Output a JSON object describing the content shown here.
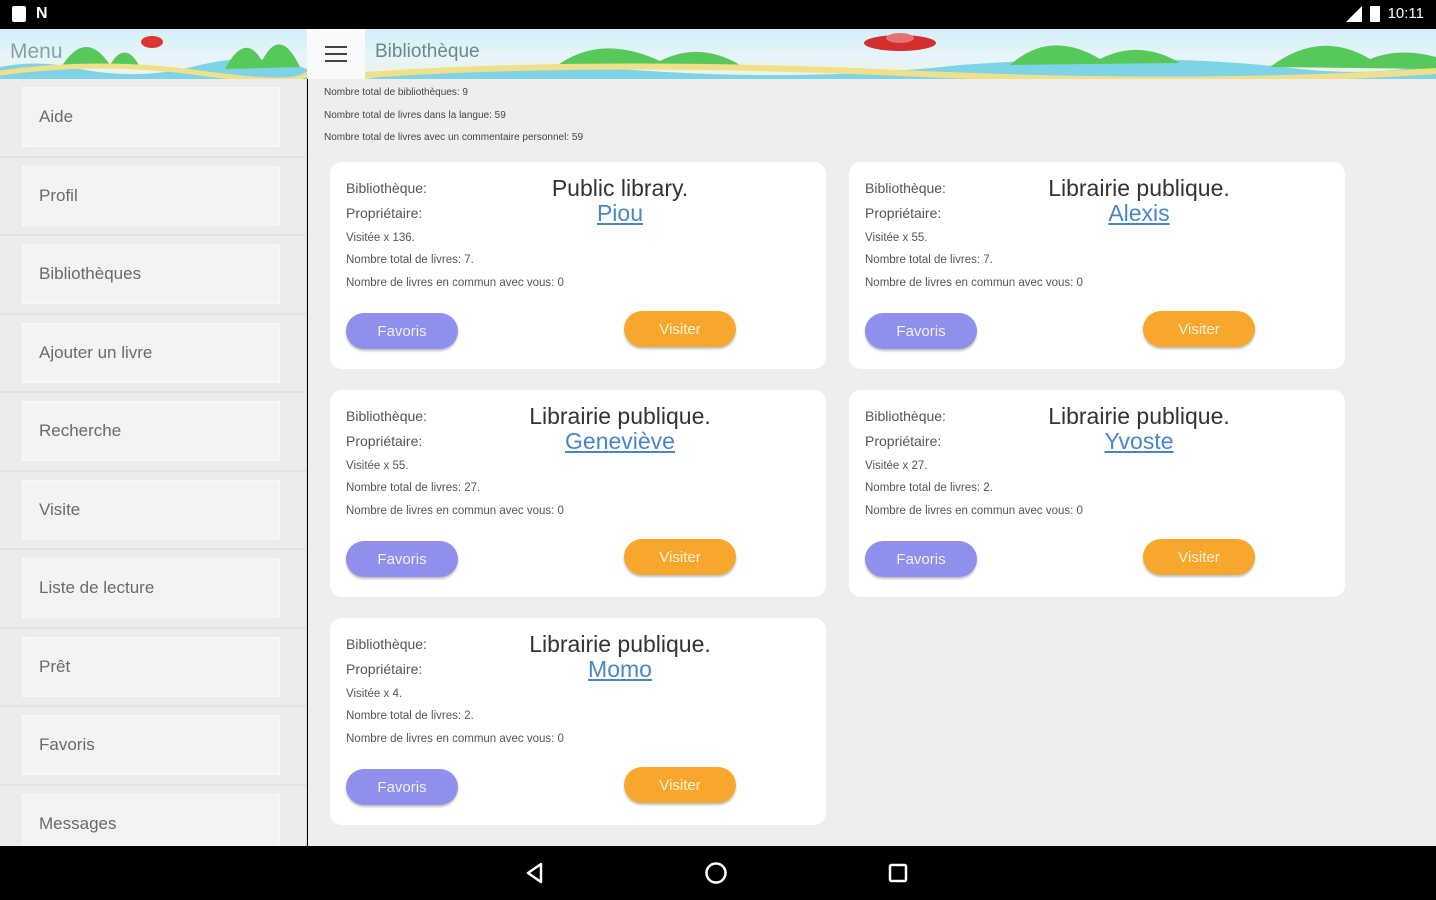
{
  "status_bar": {
    "time": "10:11",
    "carrier_icon": "N"
  },
  "header": {
    "menu_title": "Menu",
    "page_title": "Bibliothèque"
  },
  "sidebar": {
    "items": [
      {
        "label": "Aide"
      },
      {
        "label": "Profil"
      },
      {
        "label": "Bibliothèques"
      },
      {
        "label": "Ajouter un livre"
      },
      {
        "label": "Recherche"
      },
      {
        "label": "Visite"
      },
      {
        "label": "Liste de lecture"
      },
      {
        "label": "Prêt"
      },
      {
        "label": "Favoris"
      },
      {
        "label": "Messages"
      }
    ]
  },
  "stats": {
    "total_libraries": "Nombre total de bibliothèques: 9",
    "total_books_language": "Nombre total de livres dans la langue: 59",
    "total_books_comment": "Nombre total de livres avec un commentaire personnel: 59"
  },
  "labels": {
    "library": "Bibliothèque:",
    "owner": "Propriétaire:",
    "favorite_button": "Favoris",
    "visit_button": "Visiter"
  },
  "cards": [
    {
      "name": "Public library.",
      "owner": "Piou",
      "visits": "Visitée x 136.",
      "total_books": "Nombre total de livres: 7.",
      "common_books": "Nombre de livres en commun avec vous: 0"
    },
    {
      "name": "Librairie publique.",
      "owner": "Alexis",
      "visits": "Visitée x 55.",
      "total_books": "Nombre total de livres: 7.",
      "common_books": "Nombre de livres en commun avec vous: 0"
    },
    {
      "name": "Librairie publique.",
      "owner": "Geneviève",
      "visits": "Visitée x 55.",
      "total_books": "Nombre total de livres: 27.",
      "common_books": "Nombre de livres en commun avec vous: 0"
    },
    {
      "name": "Librairie publique.",
      "owner": "Yvoste",
      "visits": "Visitée x 27.",
      "total_books": "Nombre total de livres: 2.",
      "common_books": "Nombre de livres en commun avec vous: 0"
    },
    {
      "name": "Librairie publique.",
      "owner": "Momo",
      "visits": "Visitée x 4.",
      "total_books": "Nombre total de livres: 2.",
      "common_books": "Nombre de livres en commun avec vous: 0"
    }
  ],
  "colors": {
    "favorite": "#8f8fec",
    "visit": "#f7a72b",
    "link": "#4a86c7"
  },
  "icons": [
    "hamburger-icon",
    "back-icon",
    "home-icon",
    "recents-icon",
    "signal-icon",
    "battery-icon"
  ]
}
